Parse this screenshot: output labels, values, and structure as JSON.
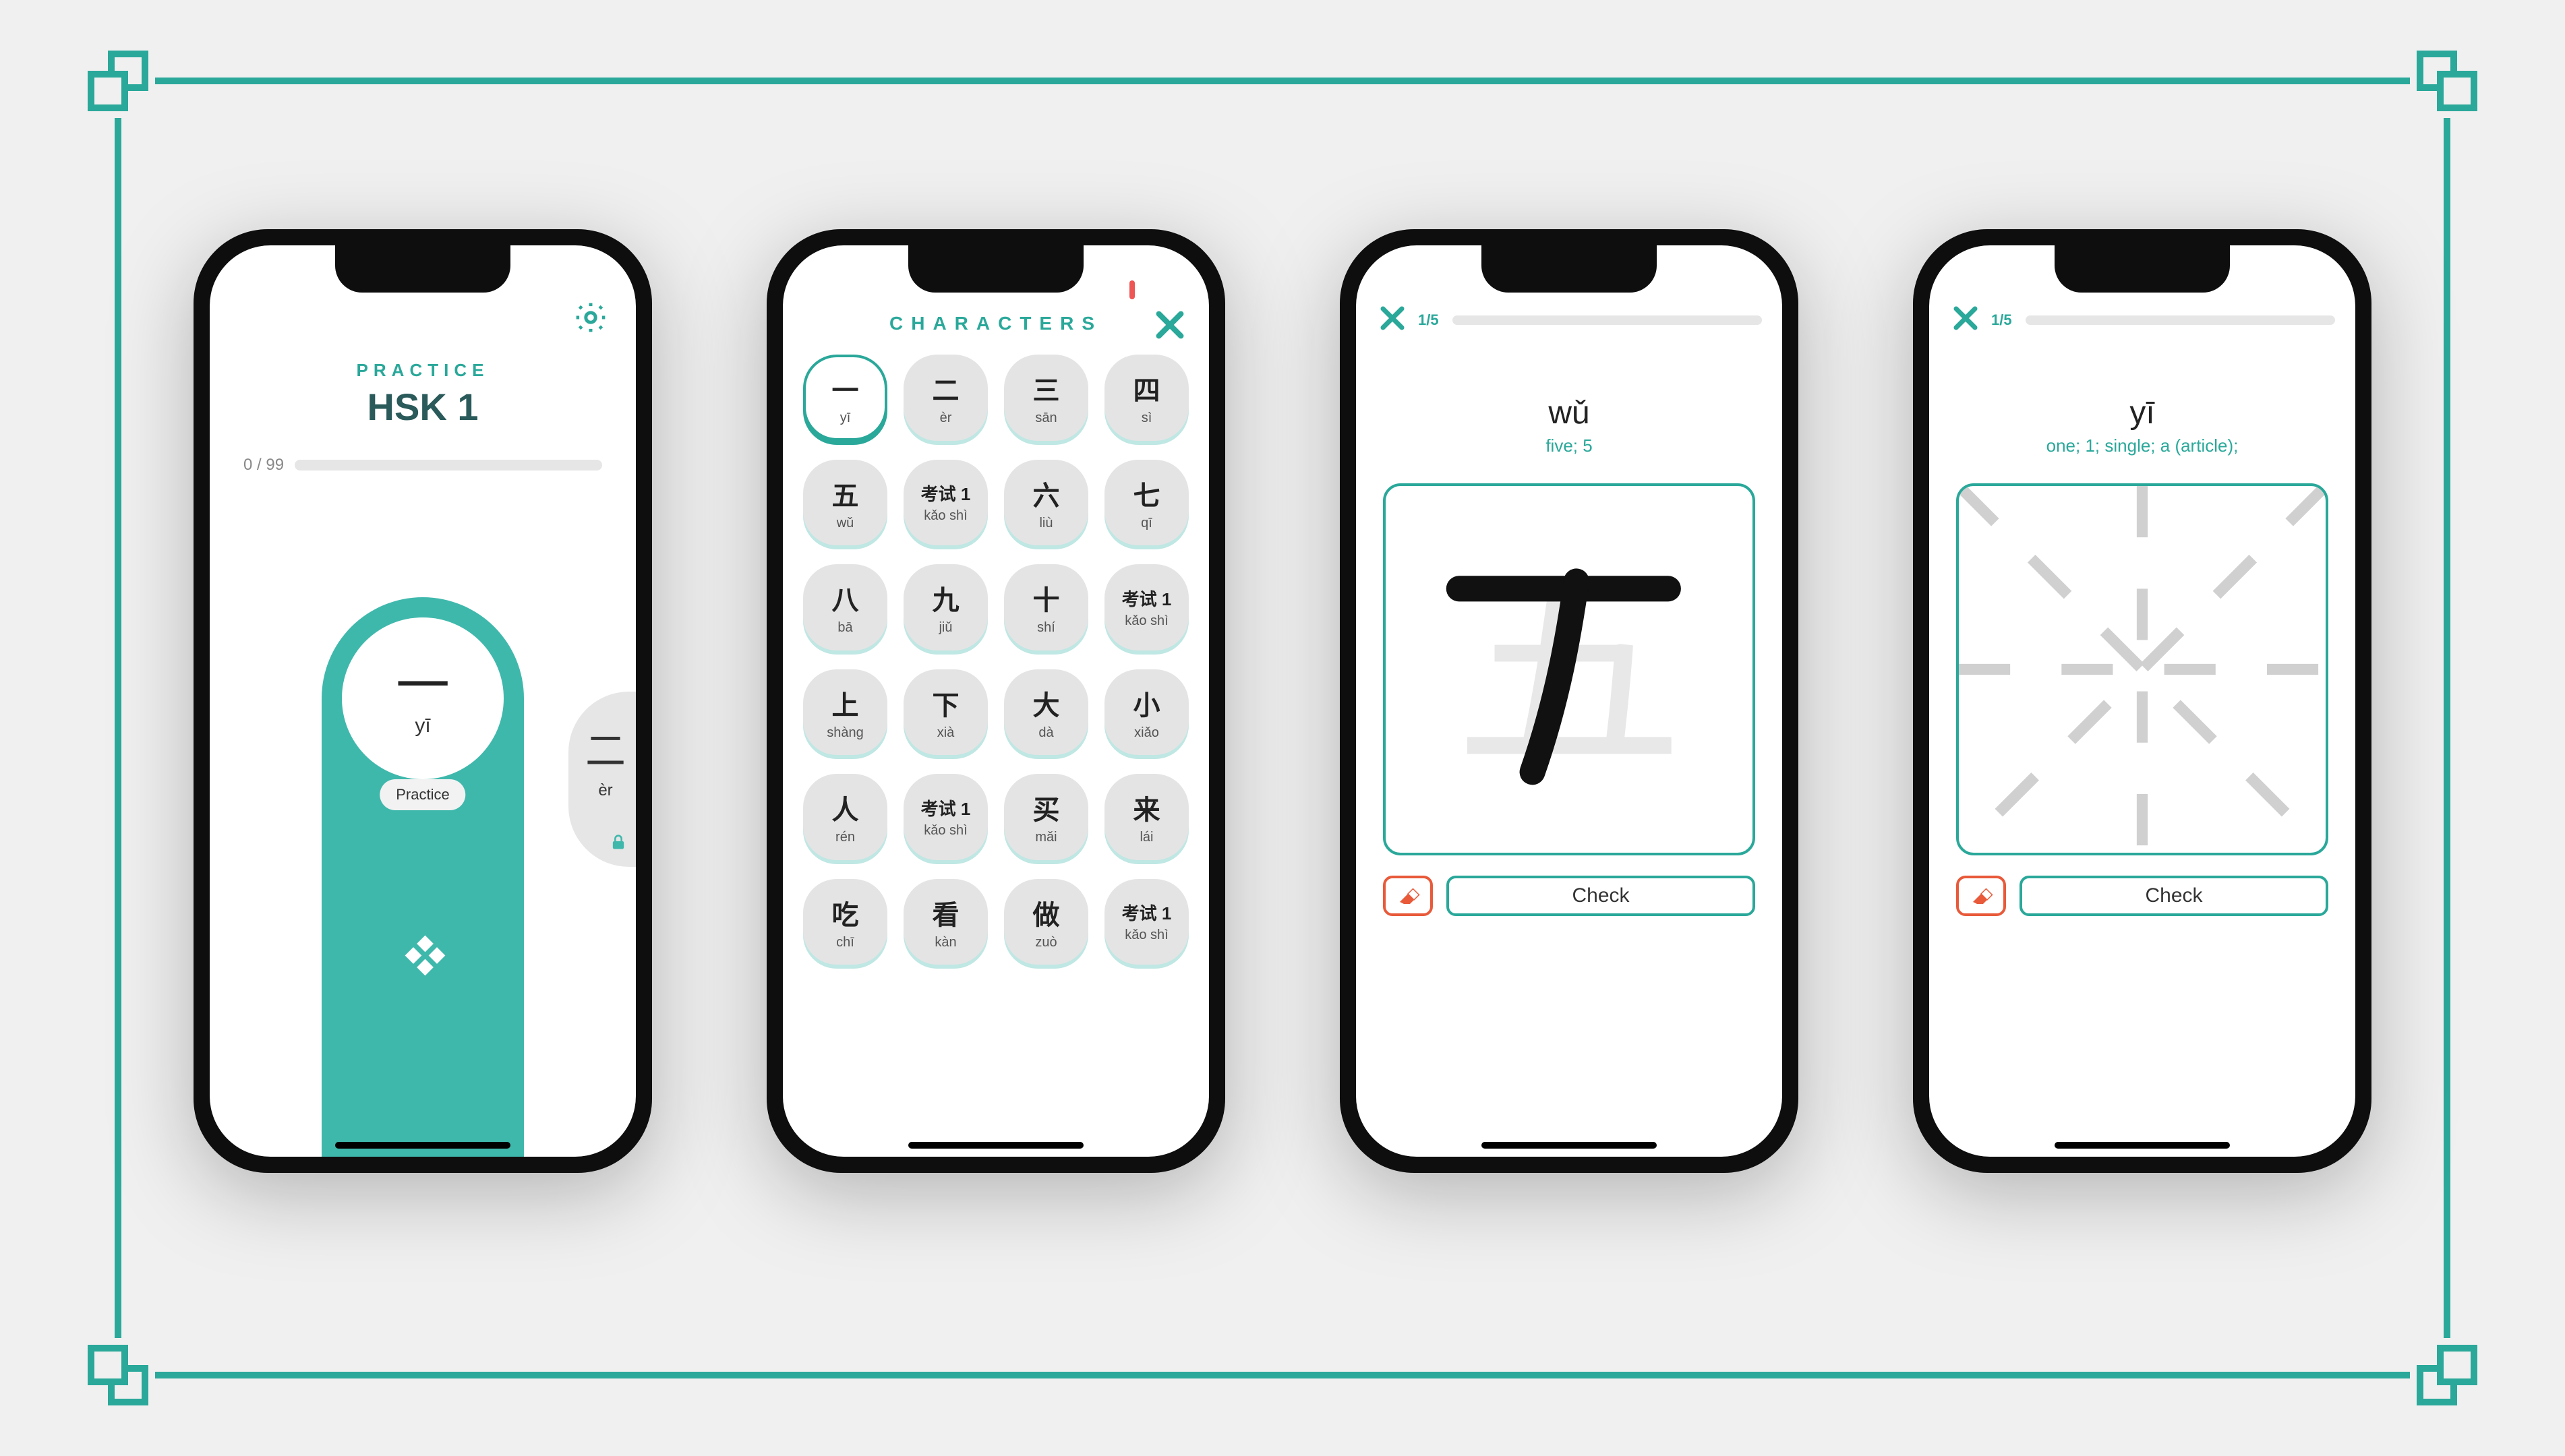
{
  "screen1": {
    "subtitle": "PRACTICE",
    "title": "HSK 1",
    "progress": "0 / 99",
    "main_card": {
      "glyph": "一",
      "pinyin": "yī",
      "button": "Practice"
    },
    "side_card": {
      "glyph": "二",
      "pinyin": "èr"
    }
  },
  "screen2": {
    "title": "CHARACTERS",
    "cells": [
      {
        "ch": "一",
        "py": "yī",
        "selected": true
      },
      {
        "ch": "二",
        "py": "èr"
      },
      {
        "ch": "三",
        "py": "sān"
      },
      {
        "ch": "四",
        "py": "sì"
      },
      {
        "ch": "五",
        "py": "wǔ"
      },
      {
        "ch": "考试 1",
        "py": "kǎo shì",
        "test": true
      },
      {
        "ch": "六",
        "py": "liù"
      },
      {
        "ch": "七",
        "py": "qī"
      },
      {
        "ch": "八",
        "py": "bā"
      },
      {
        "ch": "九",
        "py": "jiǔ"
      },
      {
        "ch": "十",
        "py": "shí"
      },
      {
        "ch": "考试 1",
        "py": "kǎo shì",
        "test": true
      },
      {
        "ch": "上",
        "py": "shàng"
      },
      {
        "ch": "下",
        "py": "xià"
      },
      {
        "ch": "大",
        "py": "dà"
      },
      {
        "ch": "小",
        "py": "xiǎo"
      },
      {
        "ch": "人",
        "py": "rén"
      },
      {
        "ch": "考试 1",
        "py": "kǎo shì",
        "test": true
      },
      {
        "ch": "买",
        "py": "mǎi"
      },
      {
        "ch": "来",
        "py": "lái"
      },
      {
        "ch": "吃",
        "py": "chī"
      },
      {
        "ch": "看",
        "py": "kàn"
      },
      {
        "ch": "做",
        "py": "zuò"
      },
      {
        "ch": "考试 1",
        "py": "kǎo shì",
        "test": true
      }
    ]
  },
  "screen3": {
    "counter": "1/5",
    "pinyin": "wǔ",
    "definition": "five; 5",
    "hint_char": "五",
    "check_label": "Check"
  },
  "screen4": {
    "counter": "1/5",
    "pinyin": "yī",
    "definition": "one; 1; single; a (article);",
    "check_label": "Check"
  }
}
